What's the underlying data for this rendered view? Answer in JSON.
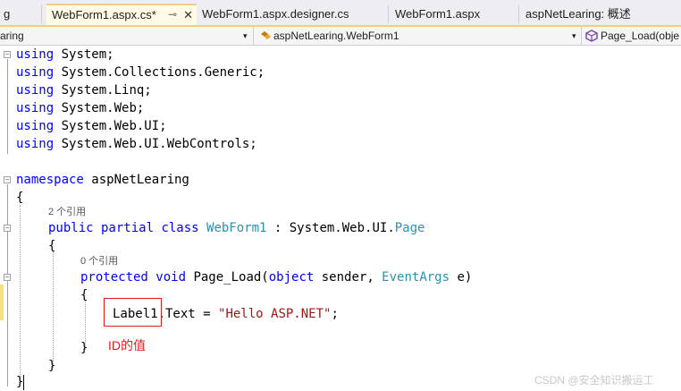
{
  "tabs": [
    {
      "label": "g"
    },
    {
      "label": "WebForm1.aspx.cs*",
      "active": true,
      "pin": "⊸",
      "close": "✕"
    },
    {
      "label": "WebForm1.aspx.designer.cs"
    },
    {
      "label": "WebForm1.aspx"
    },
    {
      "label": "aspNetLearing: 概述"
    }
  ],
  "navbar": {
    "project": "aring",
    "class": "aspNetLearing.WebForm1",
    "member": "Page_Load(obje",
    "arrow": "▾"
  },
  "code": {
    "using1": {
      "kw": "using",
      "rest": " System;"
    },
    "using2": {
      "kw": "using",
      "rest": " System.Collections.Generic;"
    },
    "using3": {
      "kw": "using",
      "rest": " System.Linq;"
    },
    "using4": {
      "kw": "using",
      "rest": " System.Web;"
    },
    "using5": {
      "kw": "using",
      "rest": " System.Web.UI;"
    },
    "using6": {
      "kw": "using",
      "rest": " System.Web.UI.WebControls;"
    },
    "ns_kw": "namespace",
    "ns_name": " aspNetLearing",
    "brace_open": "{",
    "brace_close": "}",
    "class_refs": "2 个引用",
    "class_public": "public",
    "class_partial": " partial",
    "class_class": " class",
    "class_name": " WebForm1",
    "class_colon": " : System.Web.UI.",
    "class_base": "Page",
    "method_refs": "0 个引用",
    "m_protected": "protected",
    "m_void": " void",
    "m_name": " Page_Load(",
    "m_object": "object",
    "m_sender": " sender, ",
    "m_eventargs": "EventArgs",
    "m_e": " e)",
    "stmt_label": "Label1",
    "stmt_mid": ".Text = ",
    "stmt_string": "\"Hello ASP.NET\"",
    "stmt_end": ";"
  },
  "annotation": {
    "text": "ID的值",
    "color": "#e02020"
  },
  "watermark": "CSDN @安全知识搬运工",
  "colors": {
    "keyword": "#0000ff",
    "type": "#2b91af",
    "string": "#a31515",
    "active_tab": "#f5cc84"
  }
}
